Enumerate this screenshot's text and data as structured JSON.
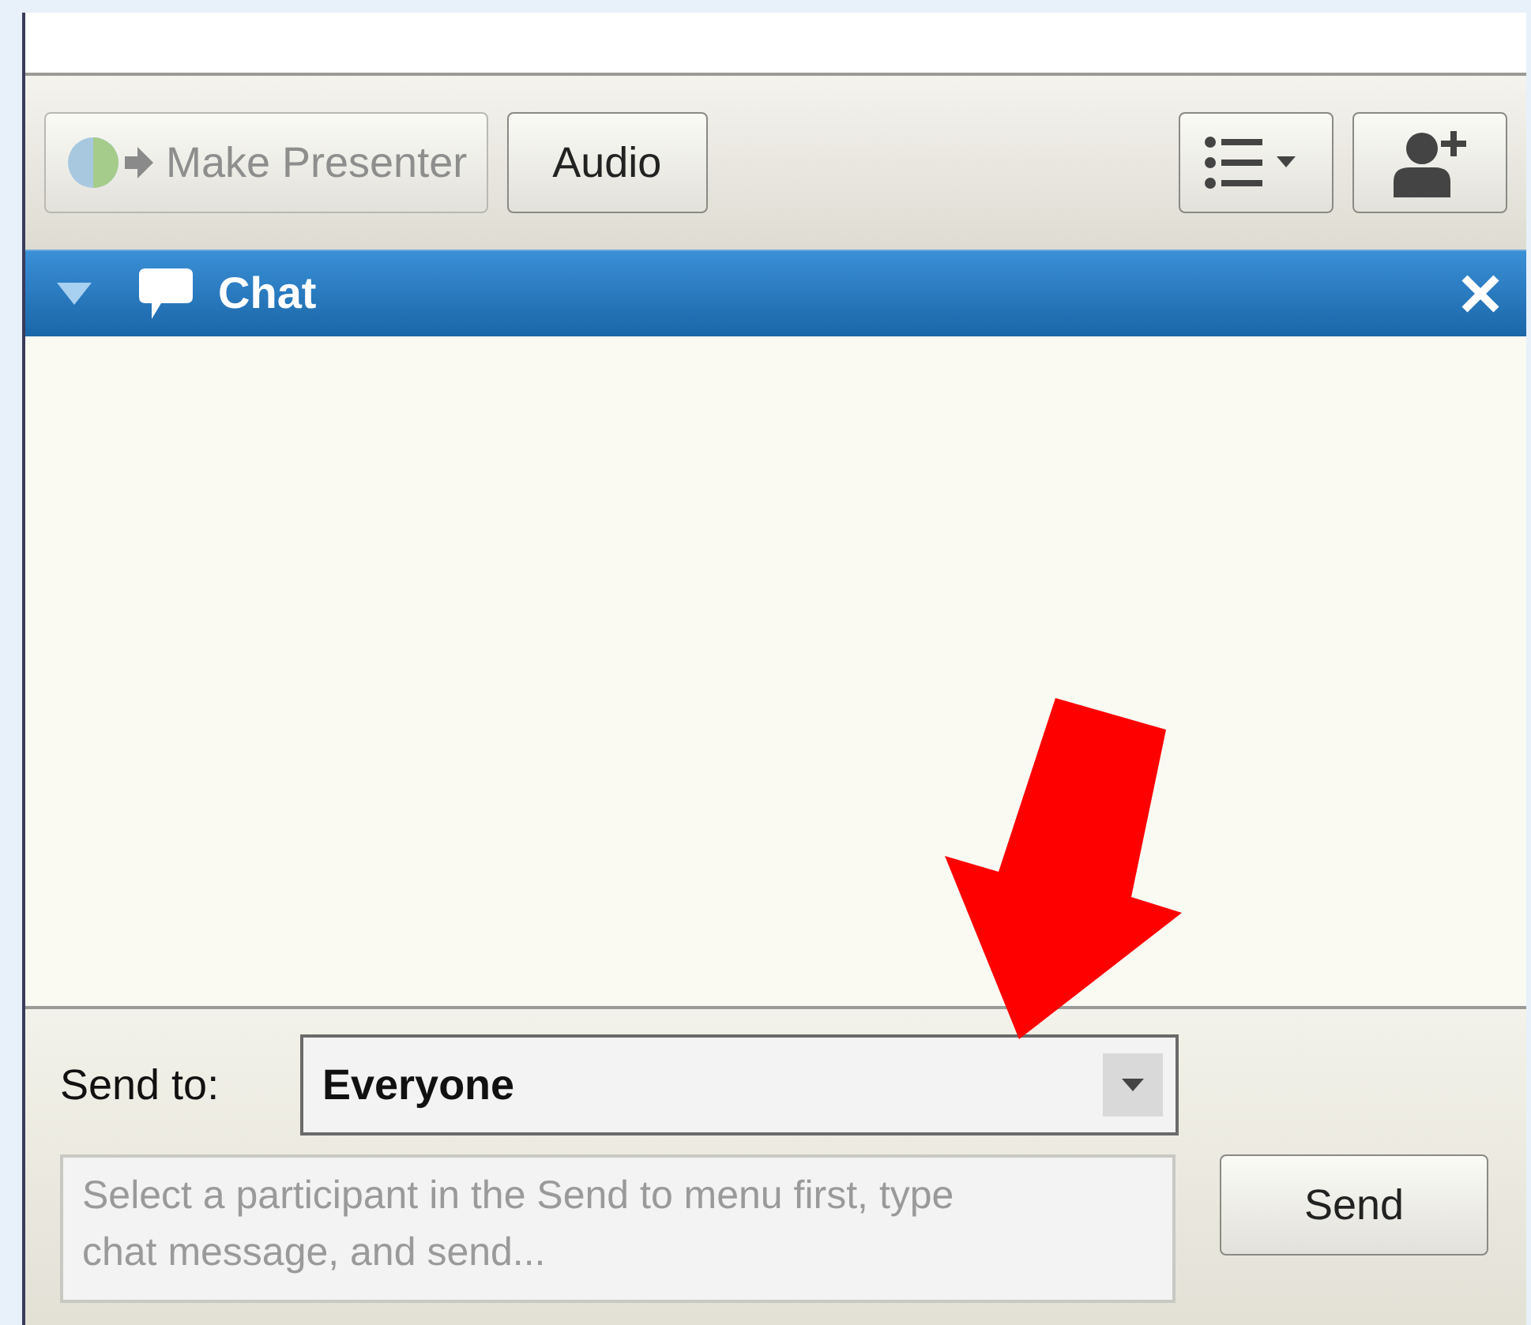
{
  "toolbar": {
    "buttons": [
      {
        "kind": "presenter",
        "label": "Make Presenter",
        "disabled": true
      },
      {
        "kind": "text",
        "label": "Audio",
        "disabled": false
      }
    ]
  },
  "panel": {
    "title": "Chat",
    "expanded": true
  },
  "composer": {
    "send_to_label": "Send to:",
    "recipient": "Everyone",
    "message": {
      "placeholder": "Select a participant in the Send to menu first, type chat message, and send..."
    },
    "send_button": "Send"
  }
}
